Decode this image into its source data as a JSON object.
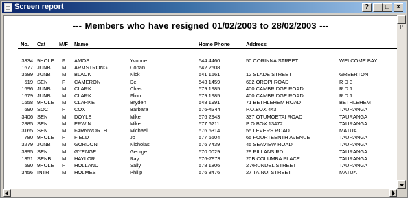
{
  "window": {
    "title": "Screen report"
  },
  "controls": {
    "help": "?",
    "minimize": "_",
    "maximize": "□",
    "close": "×"
  },
  "report": {
    "title": "---  Members who have resigned  01/02/2003 to 28/02/2003  ---",
    "columns": {
      "no": "No.",
      "cat": "Cat",
      "mf": "M/F",
      "name": "Name",
      "phone": "Home Phone",
      "address": "Address"
    },
    "rows": [
      {
        "no": "3334",
        "cat": "9HOLE",
        "mf": "F",
        "surname": "AMOS",
        "first": "Yvonne",
        "phone": "544 4460",
        "address": "50 CORINNA STREET",
        "city": "WELCOME BAY"
      },
      {
        "no": "1677",
        "cat": "JUNB",
        "mf": "M",
        "surname": "ARMSTRONG",
        "first": "Conan",
        "phone": "542 2508",
        "address": "",
        "city": ""
      },
      {
        "no": "3589",
        "cat": "JUNB",
        "mf": "M",
        "surname": "BLACK",
        "first": "Nick",
        "phone": "541 1661",
        "address": "12 SLADE STREET",
        "city": "GREERTON"
      },
      {
        "no": "519",
        "cat": "SEN",
        "mf": "F",
        "surname": "CAMERON",
        "first": "Del",
        "phone": "543 1459",
        "address": "682 OROPI ROAD",
        "city": "R D 3"
      },
      {
        "no": "1696",
        "cat": "JUNB",
        "mf": "M",
        "surname": "CLARK",
        "first": "Chas",
        "phone": "579 1985",
        "address": "400 CAMBRIDGE ROAD",
        "city": "R D 1"
      },
      {
        "no": "1679",
        "cat": "JUNB",
        "mf": "M",
        "surname": "CLARK",
        "first": "Flinn",
        "phone": "579 1985",
        "address": "400 CAMBRIDGE ROAD",
        "city": "R D 1"
      },
      {
        "no": "1658",
        "cat": "9HOLE",
        "mf": "M",
        "surname": "CLARKE",
        "first": "Bryden",
        "phone": "548 1991",
        "address": "71 BETHLEHEM ROAD",
        "city": "BETHLEHEM"
      },
      {
        "no": "690",
        "cat": "SOC",
        "mf": "F",
        "surname": "COX",
        "first": "Barbara",
        "phone": "576-4344",
        "address": "P.O.BOX 443",
        "city": "TAURANGA"
      },
      {
        "no": "3406",
        "cat": "SEN",
        "mf": "M",
        "surname": "DOYLE",
        "first": "Mike",
        "phone": "576 2943",
        "address": "337 OTUMOETAI ROAD",
        "city": "TAURANGA"
      },
      {
        "no": "2885",
        "cat": "SEN",
        "mf": "M",
        "surname": "ERWIN",
        "first": "Mike",
        "phone": "577 6211",
        "address": "P O BOX 13472",
        "city": "TAURANGA"
      },
      {
        "no": "3165",
        "cat": "SEN",
        "mf": "M",
        "surname": "FARNWORTH",
        "first": "Michael",
        "phone": "576 6314",
        "address": "55 LEVERS ROAD",
        "city": "MATUA"
      },
      {
        "no": "780",
        "cat": "9HOLE",
        "mf": "F",
        "surname": "FIELD",
        "first": "Jo",
        "phone": "577 6504",
        "address": "65 FOURTEENTH AVENUE",
        "city": "TAURANGA"
      },
      {
        "no": "3279",
        "cat": "JUNB",
        "mf": "M",
        "surname": "GORDON",
        "first": "Nicholas",
        "phone": "576 7439",
        "address": "45 SEAVIEW ROAD",
        "city": "TAURANGA"
      },
      {
        "no": "3395",
        "cat": "SEN",
        "mf": "M",
        "surname": "GYENGE",
        "first": "George",
        "phone": "570 0029",
        "address": "29 PILLANS RD",
        "city": "TAURANGA"
      },
      {
        "no": "1351",
        "cat": "SENB",
        "mf": "M",
        "surname": "HAYLOR",
        "first": "Ray",
        "phone": "576-7973",
        "address": "20B COLUMBA PLACE",
        "city": "TAURANGA"
      },
      {
        "no": "590",
        "cat": "9HOLE",
        "mf": "F",
        "surname": "HOLLAND",
        "first": "Sally",
        "phone": "578 1806",
        "address": "2 ARUNDEL STREET",
        "city": "TAURANGA"
      },
      {
        "no": "3456",
        "cat": "INTR",
        "mf": "M",
        "surname": "HOLMES",
        "first": "Philip",
        "phone": "576 8476",
        "address": "27 TAINUI STREET",
        "city": "MATUA"
      }
    ]
  },
  "scrollbar": {
    "page_label": "P"
  }
}
